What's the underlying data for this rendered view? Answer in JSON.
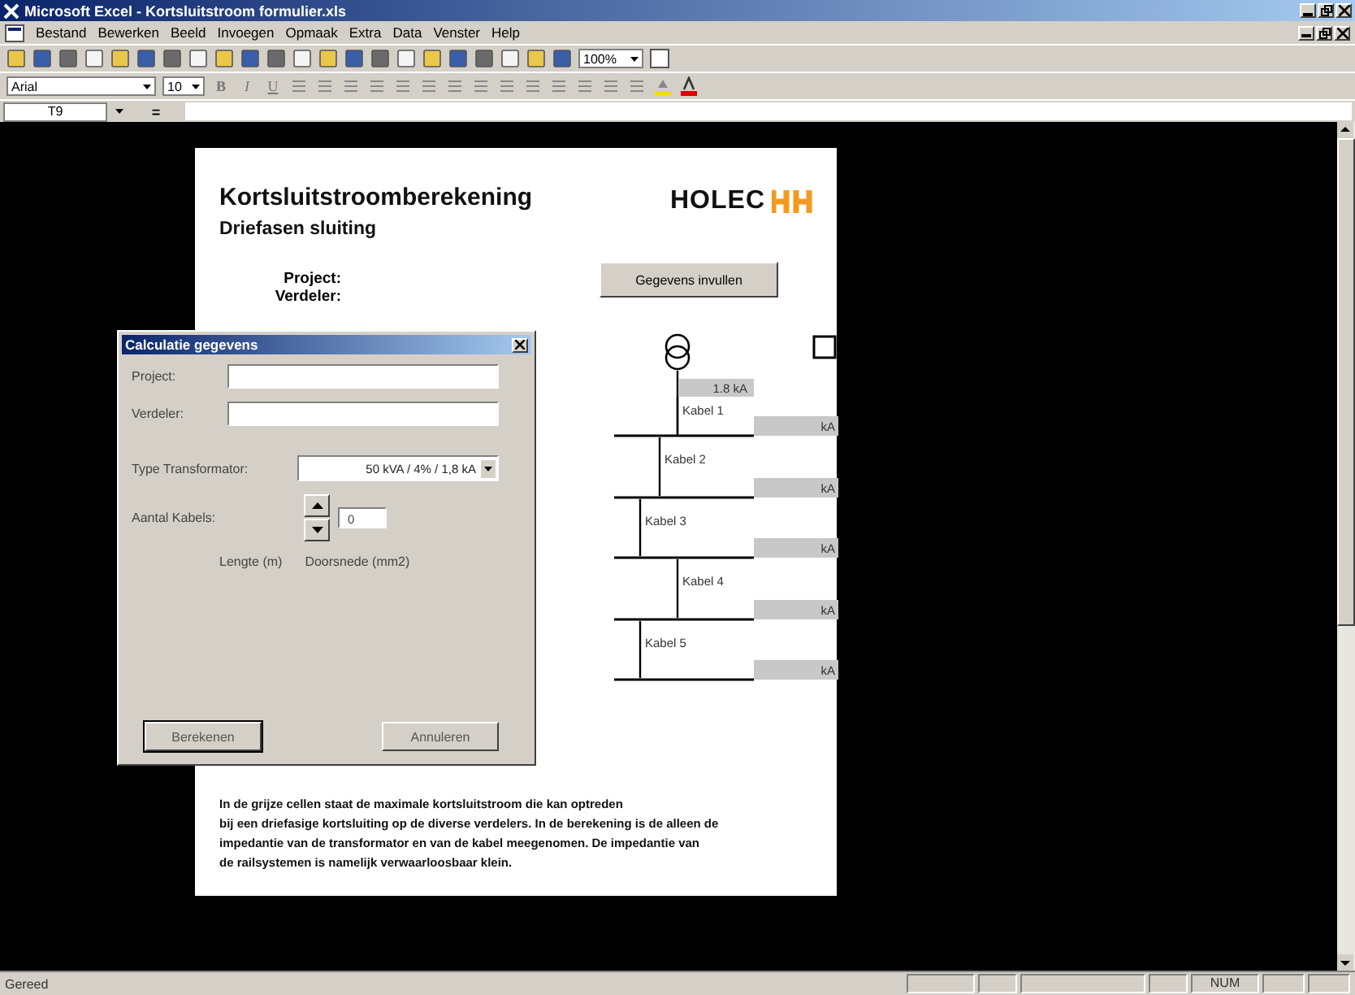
{
  "window": {
    "title": "Microsoft Excel - Kortsluitstroom formulier.xls"
  },
  "menu": [
    "Bestand",
    "Bewerken",
    "Beeld",
    "Invoegen",
    "Opmaak",
    "Extra",
    "Data",
    "Venster",
    "Help"
  ],
  "standard_toolbar": {
    "zoom": "100%"
  },
  "format_toolbar": {
    "font": "Arial",
    "size": "10",
    "style_buttons": [
      "B",
      "I",
      "U"
    ]
  },
  "formula_bar": {
    "name_box": "T9",
    "equals": "="
  },
  "sheet": {
    "title": "Kortsluitstroomberekening",
    "subtitle": "Driefasen sluiting",
    "logo": "HOLEC",
    "labels": [
      "Project:",
      "Verdeler:"
    ],
    "button": "Gegevens invullen",
    "diagram": {
      "supply_reading": "1.8  kA",
      "cables": [
        {
          "label": "Kabel 1",
          "reading": "kA"
        },
        {
          "label": "Kabel 2",
          "reading": "kA"
        },
        {
          "label": "Kabel 3",
          "reading": "kA"
        },
        {
          "label": "Kabel 4",
          "reading": "kA"
        },
        {
          "label": "Kabel 5",
          "reading": "kA"
        }
      ]
    },
    "note": [
      "In de grijze cellen staat de maximale kortsluitstroom die kan optreden",
      "bij een driefasige kortsluiting op de diverse verdelers. In de berekening is de alleen de",
      "impedantie van de transformator en van de kabel meegenomen. De impedantie van",
      "de railsystemen is namelijk verwaarloosbaar klein."
    ]
  },
  "dialog": {
    "title": "Calculatie gegevens",
    "fields": [
      {
        "label": "Project:"
      },
      {
        "label": "Verdeler:"
      }
    ],
    "transformer": {
      "label": "Type Transformator:",
      "value": "50 kVA   /  4%  / 1,8 kA"
    },
    "cables": {
      "label": "Aantal Kabels:",
      "value": "0"
    },
    "columns": [
      "Lengte (m)",
      "Doorsnede (mm2)"
    ],
    "buttons": [
      "Berekenen",
      "Annuleren"
    ]
  },
  "status_bar": {
    "text": "Gereed",
    "num": "NUM"
  }
}
